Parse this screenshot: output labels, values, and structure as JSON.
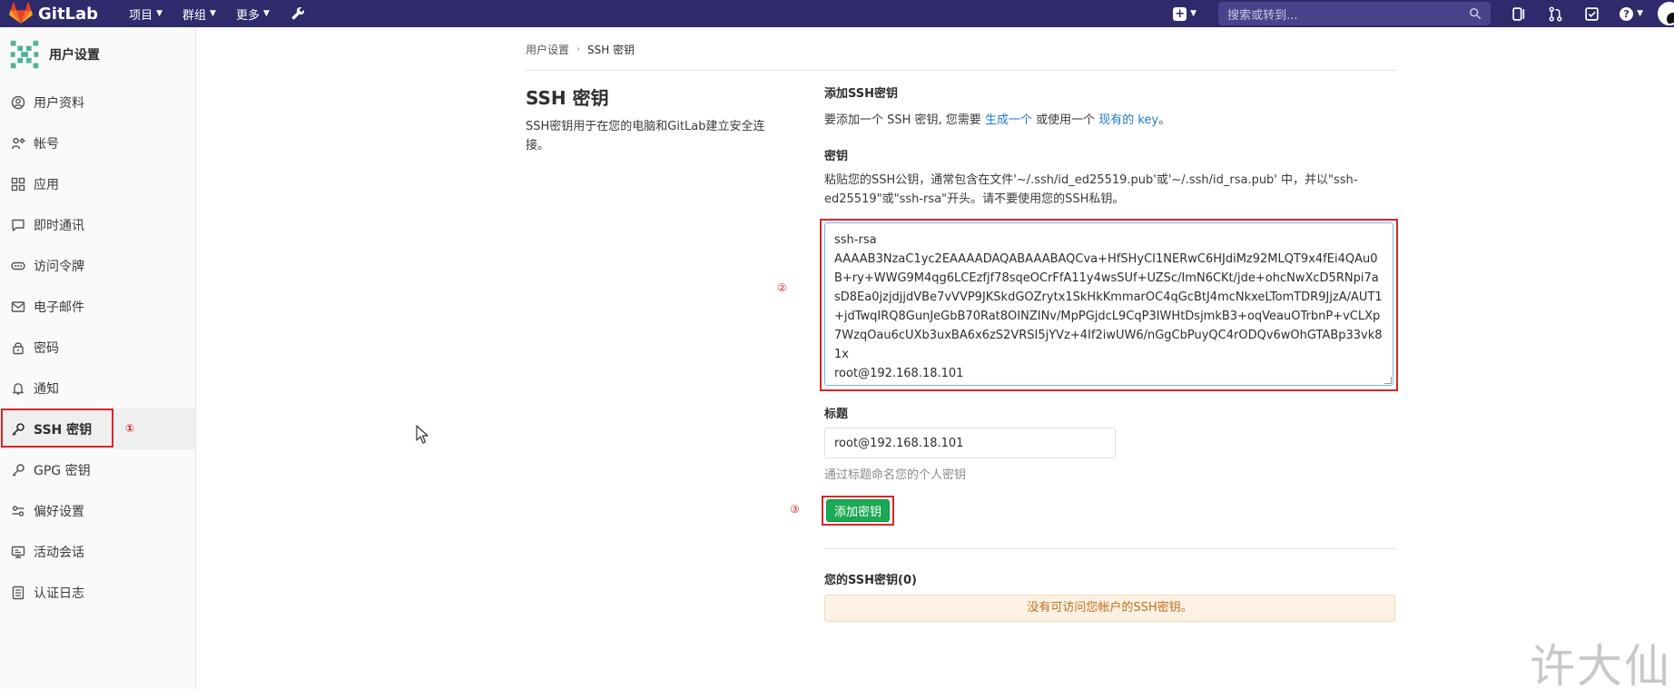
{
  "navbar": {
    "brand": "GitLab",
    "menu": [
      {
        "label": "项目"
      },
      {
        "label": "群组"
      },
      {
        "label": "更多"
      }
    ],
    "search_placeholder": "搜索或转到...",
    "colors": {
      "background": "#2f2a6b",
      "search": "#48438a"
    }
  },
  "sidebar": {
    "title": "用户设置",
    "items": [
      {
        "label": "用户资料",
        "icon": "user-circle-icon"
      },
      {
        "label": "帐号",
        "icon": "account-gear-icon"
      },
      {
        "label": "应用",
        "icon": "applications-grid-icon"
      },
      {
        "label": "即时通讯",
        "icon": "chat-bubble-icon"
      },
      {
        "label": "访问令牌",
        "icon": "token-icon"
      },
      {
        "label": "电子邮件",
        "icon": "mail-icon"
      },
      {
        "label": "密码",
        "icon": "lock-icon"
      },
      {
        "label": "通知",
        "icon": "bell-icon"
      },
      {
        "label": "SSH 密钥",
        "icon": "key-icon",
        "active": true
      },
      {
        "label": "GPG 密钥",
        "icon": "key-icon"
      },
      {
        "label": "偏好设置",
        "icon": "preferences-icon"
      },
      {
        "label": "活动会话",
        "icon": "monitor-icon"
      },
      {
        "label": "认证日志",
        "icon": "log-list-icon"
      }
    ]
  },
  "breadcrumb": {
    "parent": "用户设置",
    "current": "SSH 密钥"
  },
  "page": {
    "title": "SSH 密钥",
    "description": "SSH密钥用于在您的电脑和GitLab建立安全连接。"
  },
  "form": {
    "add_title": "添加SSH密钥",
    "intro_before": "要添加一个 SSH 密钥, 您需要 ",
    "intro_link1": "生成一个",
    "intro_middle": " 或使用一个 ",
    "intro_link2": "现有的 key",
    "intro_after": "。",
    "key_label": "密钥",
    "key_help": "粘贴您的SSH公钥，通常包含在文件'~/.ssh/id_ed25519.pub'或'~/.ssh/id_rsa.pub' 中，并以\"ssh-ed25519\"或\"ssh-rsa\"开头。请不要使用您的SSH私钥。",
    "key_value": "ssh-rsa\nAAAAB3NzaC1yc2EAAAADAQABAAABAQCva+HfSHyCI1NERwC6HJdiMz92MLQT9x4fEi4QAu0B+ry+WWG9M4qg6LCEzfjf78sqeOCrFfA11y4wsSUf+UZSc/ImN6CKt/jde+ohcNwXcD5RNpi7asD8Ea0jzjdjjdVBe7vVVP9JKSkdGOZrytx1SkHkKmmarOC4qGcBtJ4mcNkxeLTomTDR9JjzA/AUT1+jdTwqIRQ8GunJeGbB70Rat8OINZINv/MpPGjdcL9CqP3IWHtDsjmkB3+oqVeauOTrbnP+vCLXp7WzqOau6cUXb3uxBA6x6zS2VRSI5jYVz+4If2iwUW6/nGgCbPuyQC4rODQv6wOhGTABp33vk81x\nroot@192.168.18.101",
    "title_label": "标题",
    "title_value": "root@192.168.18.101",
    "title_help": "通过标题命名您的个人密钥",
    "add_button": "添加密钥"
  },
  "keys": {
    "heading": "您的SSH密钥(0)",
    "empty_message": "没有可访问您帐户的SSH密钥。"
  },
  "annotations": {
    "step1": "①",
    "step2": "②",
    "step3": "③",
    "color": "#d62728"
  },
  "watermark": "许大仙"
}
